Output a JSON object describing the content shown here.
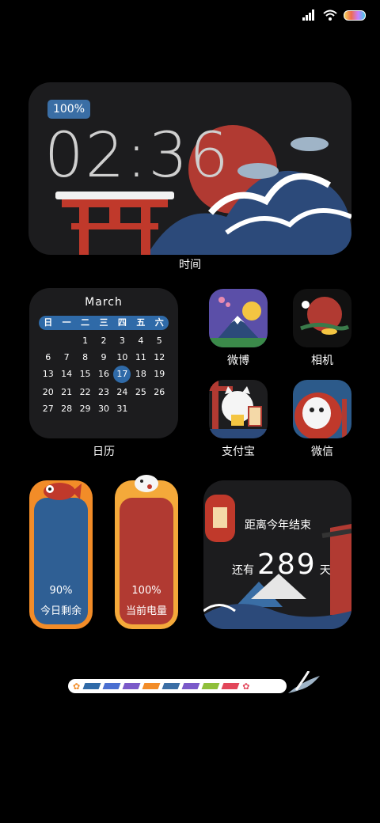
{
  "status_bar": {
    "signal_icon": "signal-icon",
    "wifi_icon": "wifi-icon",
    "battery_icon": "battery-icon"
  },
  "clock_widget": {
    "battery_badge": "100%",
    "time": "02:36",
    "label": "时间"
  },
  "calendar": {
    "month": "March",
    "weekdays": [
      "日",
      "一",
      "二",
      "三",
      "四",
      "五",
      "六"
    ],
    "days": [
      "",
      "",
      "1",
      "2",
      "3",
      "4",
      "5",
      "6",
      "7",
      "8",
      "9",
      "10",
      "11",
      "12",
      "13",
      "14",
      "15",
      "16",
      "17",
      "18",
      "19",
      "20",
      "21",
      "22",
      "23",
      "24",
      "25",
      "26",
      "27",
      "28",
      "29",
      "30",
      "31",
      "",
      "",
      ""
    ],
    "today": "17",
    "label": "日历"
  },
  "apps": [
    {
      "label": "微博"
    },
    {
      "label": "相机"
    },
    {
      "label": "支付宝"
    },
    {
      "label": "微信"
    }
  ],
  "today_remaining": {
    "percent": "90%",
    "label": "今日剩余",
    "value": 0.9
  },
  "battery_widget": {
    "percent": "100%",
    "label": "当前电量",
    "value": 1.0
  },
  "countdown": {
    "title": "距离今年结束",
    "prefix": "还有",
    "days": "289",
    "suffix": "天"
  },
  "colors": {
    "accent": "#2f6aa8",
    "red": "#b13a32",
    "orange": "#f28c28",
    "navy": "#2c4a7a",
    "widget_bg": "#1c1c1e"
  },
  "deco_bar_colors": [
    "#2f6aa8",
    "#4a6fd1",
    "#7a59c9",
    "#f28c28",
    "#3a6ea5",
    "#7a59c9",
    "#8fbf3a",
    "#e2465a"
  ]
}
